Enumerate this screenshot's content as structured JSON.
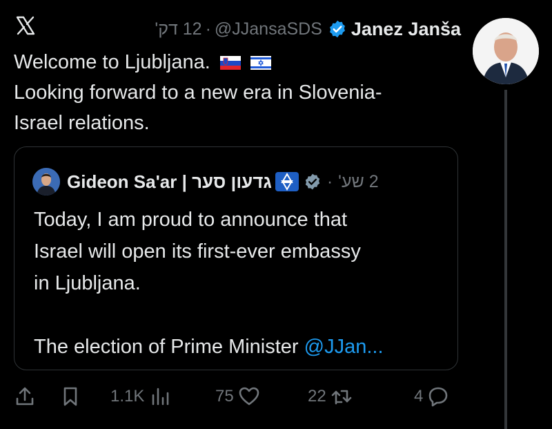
{
  "app": {
    "logo_icon": "x-logo-icon"
  },
  "tweet": {
    "time": "12 דק'",
    "separator": "·",
    "handle": "@JJansaSDS",
    "author": "Janez Janša",
    "verified_icon": "verified-badge-icon",
    "text_line1": "Welcome to Ljubljana.",
    "flags": [
      "slovenia-flag-icon",
      "israel-flag-icon"
    ],
    "text_line2": "Looking forward to a new era in Slovenia-",
    "text_line3": "Israel relations."
  },
  "quote": {
    "author": "Gideon Sa'ar | גדעון סער",
    "emblem_icon": "star-of-david-emblem-icon",
    "separator": "·",
    "time": "2 שע'",
    "line1": "Today, I am proud to announce that",
    "line2": "Israel will open its first-ever embassy",
    "line3": "in Ljubljana.",
    "line4_prefix": "The election of Prime Minister ",
    "mention": "@JJan...",
    "colors": {
      "mention": "#1d9bf0"
    }
  },
  "actions": {
    "views": "1.1K",
    "likes": "75",
    "reposts": "22",
    "replies": "4"
  },
  "colors": {
    "background": "#000000",
    "text": "#e7e9ea",
    "muted": "#71767b",
    "verified": "#1d9bf0"
  }
}
